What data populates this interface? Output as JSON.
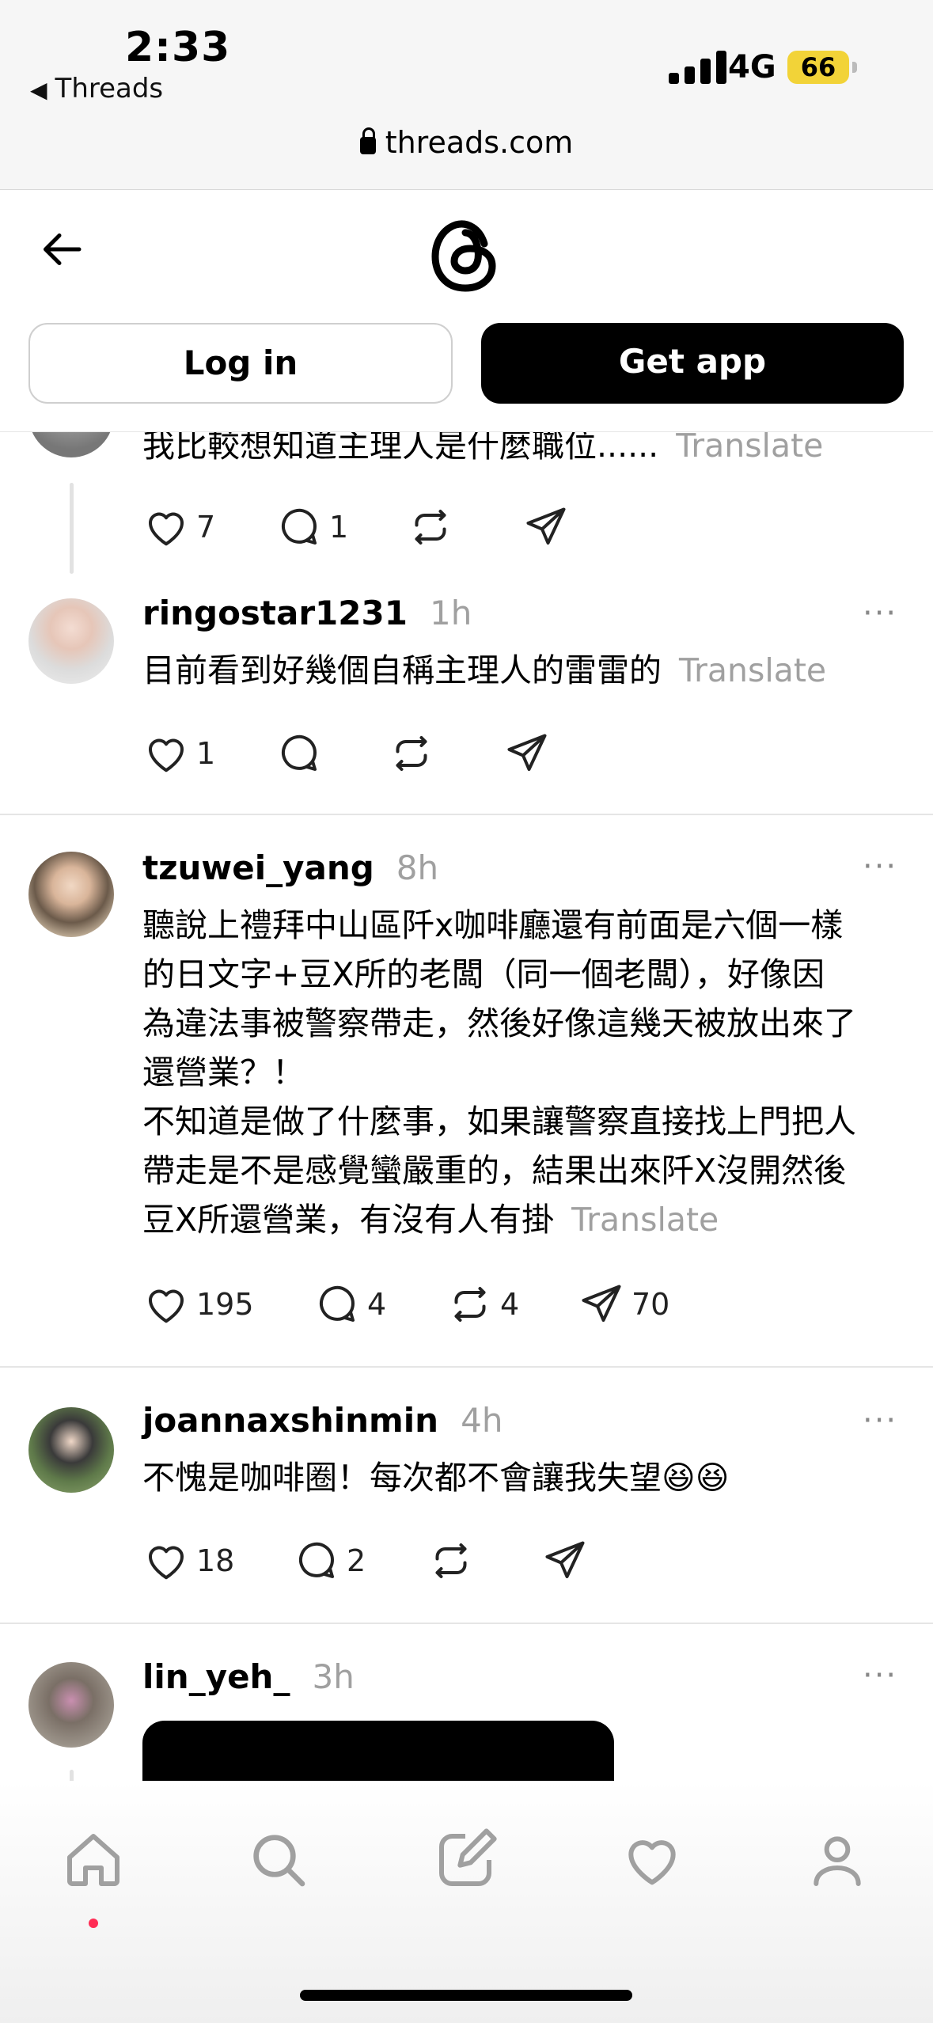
{
  "status_bar": {
    "time": "2:33",
    "back_app": "Threads",
    "network": "4G",
    "battery": "66",
    "url": "threads.com"
  },
  "header": {
    "login_label": "Log in",
    "get_app_label": "Get app"
  },
  "posts": [
    {
      "text": "我比較想知道主理人是什麼職位......",
      "translate": "Translate",
      "likes": "7",
      "replies": "1",
      "reposts": "",
      "shares": ""
    },
    {
      "username": "ringostar1231",
      "time": "1h",
      "text": "目前看到好幾個自稱主理人的雷雷的",
      "translate": "Translate",
      "likes": "1",
      "replies": "",
      "reposts": "",
      "shares": ""
    },
    {
      "username": "tzuwei_yang",
      "time": "8h",
      "text_line1": "聽說上禮拜中山區阡x咖啡廳還有前面是六個一樣",
      "text_line2": "的日文字+豆X所的老闆（同一個老闆），好像因",
      "text_line3": "為違法事被警察帶走，然後好像這幾天被放出來了",
      "text_line4": "還營業？！",
      "text_line5": "不知道是做了什麼事，如果讓警察直接找上門把人",
      "text_line6": "帶走是不是感覺蠻嚴重的，結果出來阡X沒開然後",
      "text_line7": "豆X所還營業，有沒有人有掛",
      "translate": "Translate",
      "likes": "195",
      "replies": "4",
      "reposts": "4",
      "shares": "70"
    },
    {
      "username": "joannaxshinmin",
      "time": "4h",
      "text": "不愧是咖啡圈！每次都不會讓我失望😆😆",
      "likes": "18",
      "replies": "2",
      "reposts": "",
      "shares": ""
    },
    {
      "username": "lin_yeh_",
      "time": "3h"
    }
  ],
  "more_label": "···"
}
